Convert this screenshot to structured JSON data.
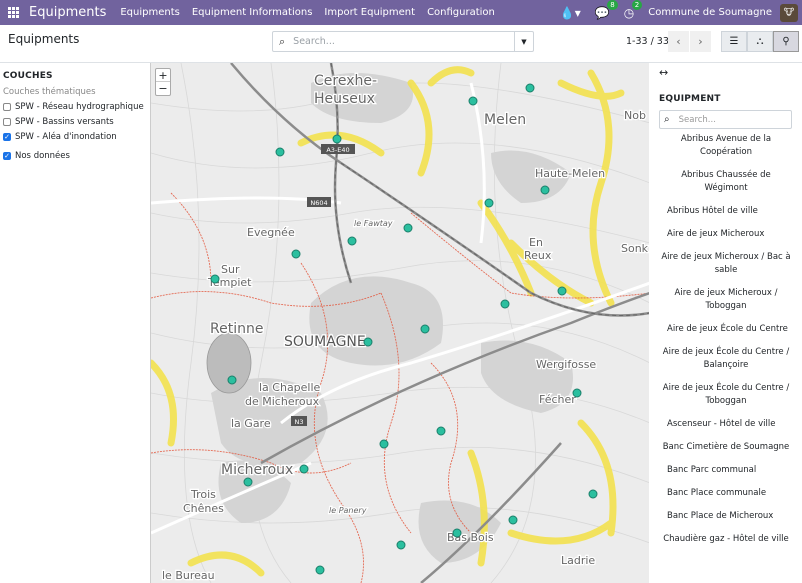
{
  "navbar": {
    "brand": "Equipments",
    "menu": [
      "Equipments",
      "Equipment Informations",
      "Import Equipment",
      "Configuration"
    ],
    "messages_count": "8",
    "activities_count": "2",
    "company": "Commune de Soumagne"
  },
  "control": {
    "breadcrumb": "Equipments",
    "search_placeholder": "Search...",
    "pager": "1-33 / 33"
  },
  "layers": {
    "title": "COUCHES",
    "subtitle": "Couches thématiques",
    "items": [
      {
        "label": "SPW - Réseau hydrographique",
        "checked": false
      },
      {
        "label": "SPW - Bassins versants",
        "checked": false
      },
      {
        "label": "SPW - Aléa d'inondation",
        "checked": true
      },
      {
        "label": "Nos données",
        "checked": true
      }
    ]
  },
  "map": {
    "labels": [
      "Cerexhe-Heuseux",
      "Melen",
      "Haute-Melen",
      "Evegnée",
      "Sur Tempiet",
      "Retinne",
      "SOUMAGNE",
      "la Chapelle de Micheroux",
      "la Gare",
      "Micheroux",
      "Trois Chênes",
      "Wergifosse",
      "Fécher",
      "En Reux",
      "Sonk",
      "Nob",
      "Bas Bois",
      "Ladrie",
      "le Bureau",
      "le Fawtay",
      "le Panery",
      "A3-E40",
      "N604",
      "N3"
    ],
    "marker_color": "#2bbf9f"
  },
  "equipment": {
    "title": "EQUIPMENT",
    "search_placeholder": "Search...",
    "items": [
      "Abribus Avenue de la Coopération",
      "Abribus Chaussée de Wégimont",
      "Abribus Hôtel de ville",
      "Aire de jeux Micheroux",
      "Aire de jeux Micheroux / Bac à sable",
      "Aire de jeux Micheroux / Toboggan",
      "Aire de jeux École du Centre",
      "Aire de jeux École du Centre / Balançoire",
      "Aire de jeux École du Centre / Toboggan",
      "Ascenseur - Hôtel de ville",
      "Banc Cimetière de Soumagne",
      "Banc Parc communal",
      "Banc Place communale",
      "Banc Place de Micheroux",
      "Chaudière gaz - Hôtel de ville"
    ]
  }
}
